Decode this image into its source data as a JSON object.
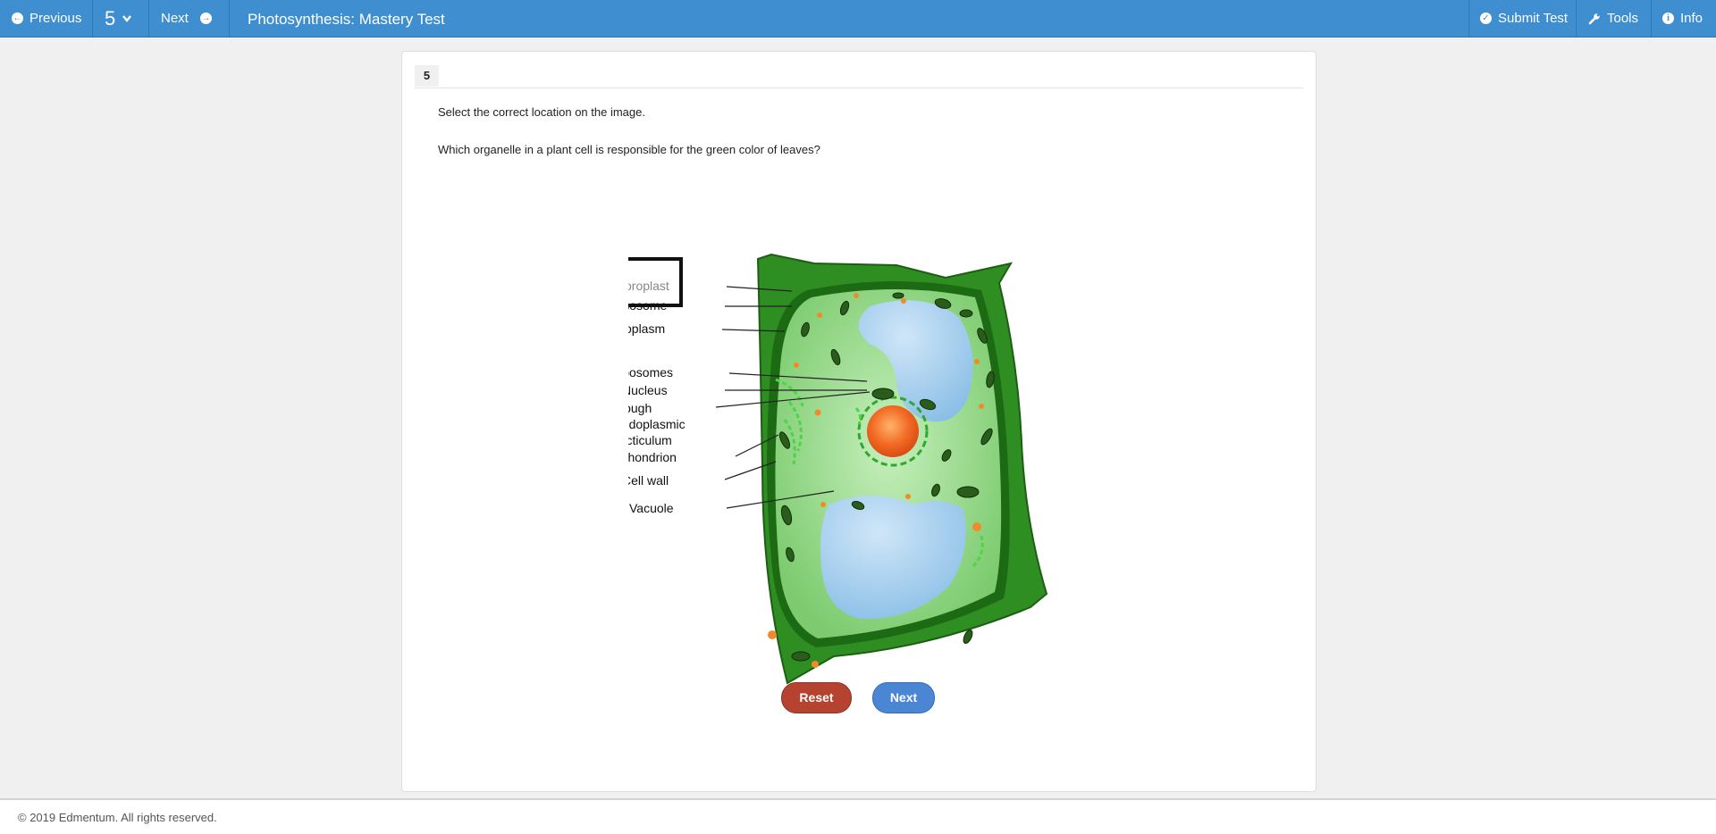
{
  "toolbar": {
    "previous_label": "Previous",
    "question_number": "5",
    "next_label": "Next",
    "test_title": "Photosynthesis: Mastery Test",
    "submit_label": "Submit Test",
    "tools_label": "Tools",
    "info_label": "Info"
  },
  "question": {
    "tab_number": "5",
    "instruction": "Select the correct location on the image.",
    "prompt": "Which organelle in a plant cell is responsible for the green color of leaves?"
  },
  "diagram": {
    "labels": {
      "chloroplast": "Chloroplast",
      "lysosome": "Lysosome",
      "cytoplasm": "Cytoplasm",
      "ribosomes": "Ribosomes",
      "nucleus": "Nucleus",
      "rough_er_line1": "Rough",
      "rough_er_line2": "endoplasmic",
      "rough_er_line3": "recticulum",
      "mitochondrion": "Mitochondrion",
      "cell_wall": "Cell wall",
      "vacuole": "Vacuole"
    },
    "colors": {
      "cell_wall": "#2f8e22",
      "cytoplasm": "#8fd184",
      "vacuole": "#9cc8ec",
      "nucleus": "#f26a24"
    }
  },
  "actions": {
    "reset_label": "Reset",
    "next_label": "Next"
  },
  "footer": {
    "copyright": "© 2019 Edmentum. All rights reserved."
  }
}
